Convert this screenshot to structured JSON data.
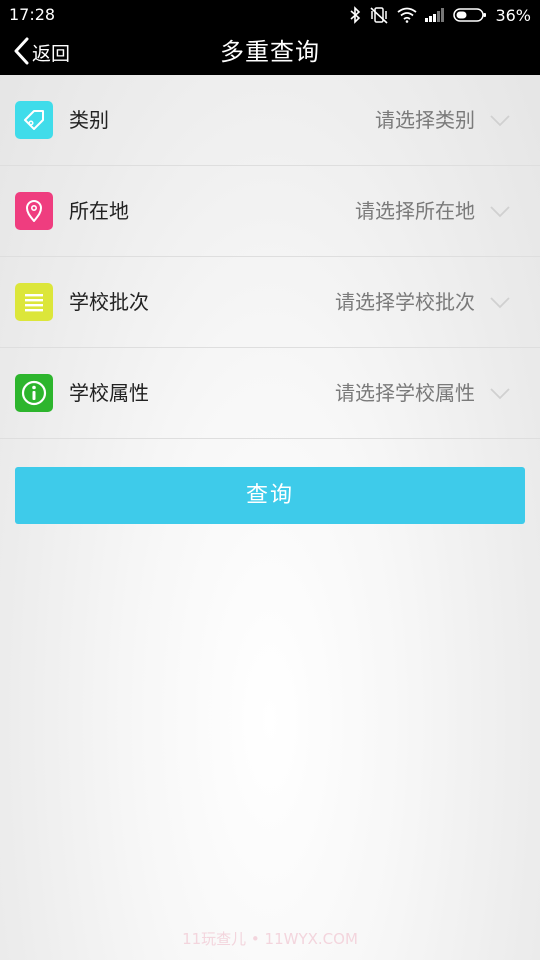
{
  "status_bar": {
    "time": "17:28",
    "battery": "36%"
  },
  "nav": {
    "back_label": "返回",
    "title": "多重查询"
  },
  "filters": [
    {
      "label": "类别",
      "placeholder": "请选择类别",
      "icon": "tag-icon",
      "icon_color": "#40dcea"
    },
    {
      "label": "所在地",
      "placeholder": "请选择所在地",
      "icon": "location-pin-icon",
      "icon_color": "#ef3d7f"
    },
    {
      "label": "学校批次",
      "placeholder": "请选择学校批次",
      "icon": "list-lines-icon",
      "icon_color": "#dce63a"
    },
    {
      "label": "学校属性",
      "placeholder": "请选择学校属性",
      "icon": "info-icon",
      "icon_color": "#2db52d"
    }
  ],
  "query_button": {
    "label": "查询",
    "color": "#3ecbea"
  },
  "watermark": "11玩查儿 • 11WYX.COM"
}
